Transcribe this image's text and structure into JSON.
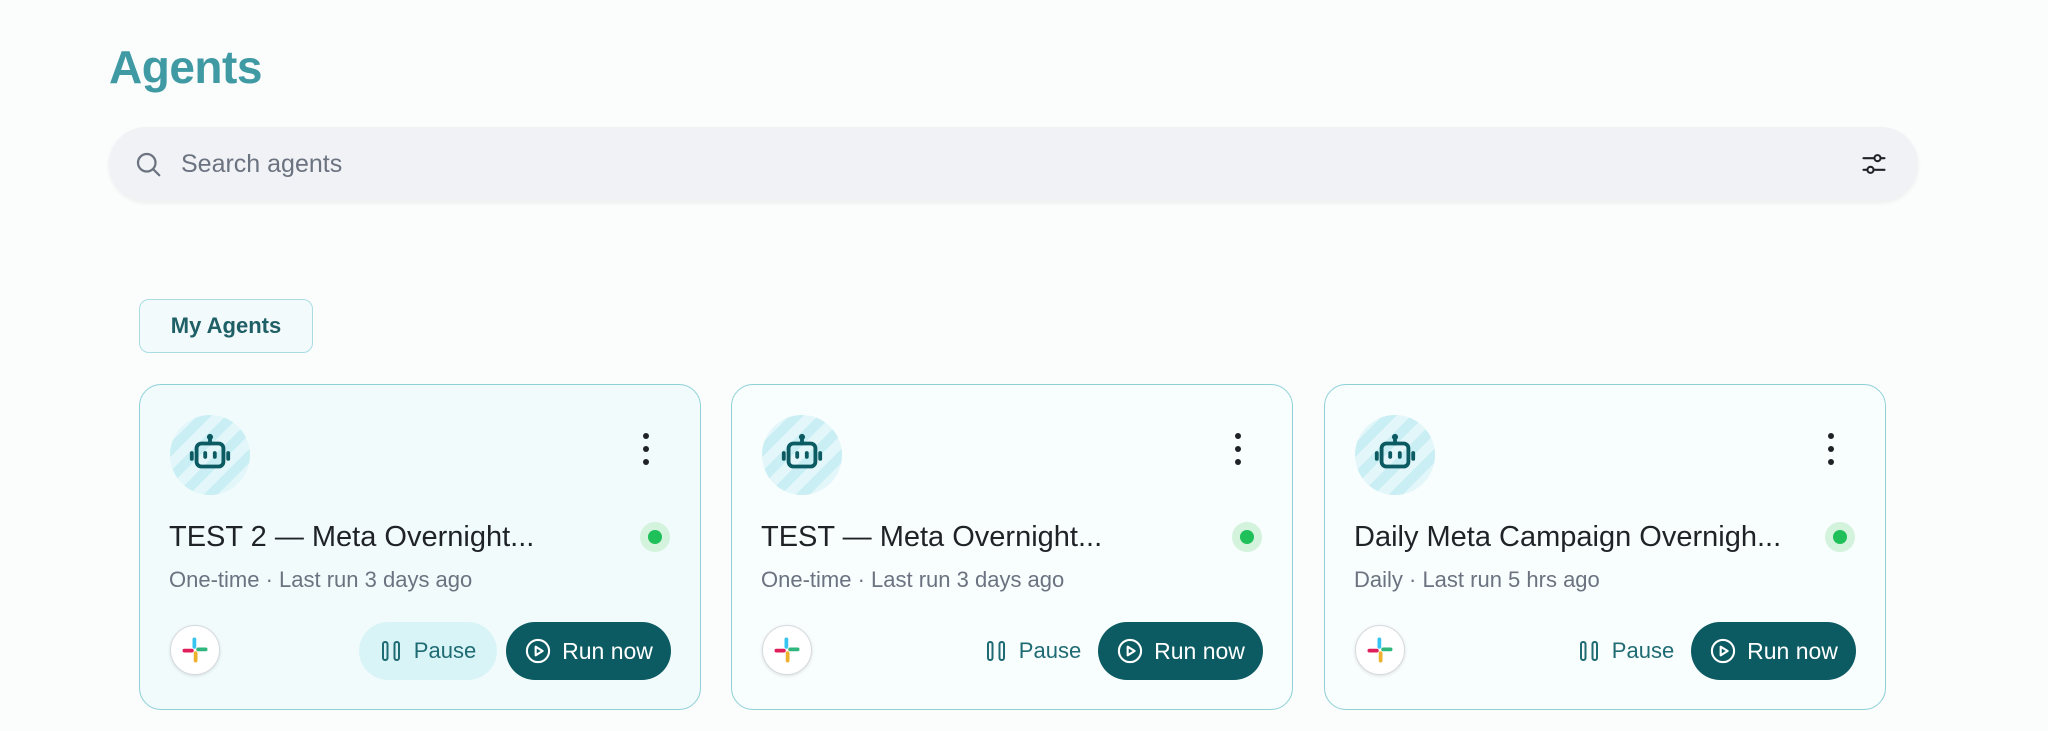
{
  "header": {
    "title": "Agents"
  },
  "search": {
    "placeholder": "Search agents",
    "value": ""
  },
  "tabs": [
    {
      "label": "My Agents"
    }
  ],
  "cards": [
    {
      "name": "TEST 2 — Meta Overnight...",
      "meta": "One-time · Last run 3 days ago",
      "pause_label": "Pause",
      "run_label": "Run now",
      "status": "active"
    },
    {
      "name": "TEST — Meta Overnight...",
      "meta": "One-time · Last run 3 days ago",
      "pause_label": "Pause",
      "run_label": "Run now",
      "status": "active"
    },
    {
      "name": "Daily Meta Campaign Overnigh...",
      "meta": "Daily · Last run 5 hrs ago",
      "pause_label": "Pause",
      "run_label": "Run now",
      "status": "active"
    }
  ],
  "colors": {
    "accent": "#3f9aa4",
    "primary_button": "#0c5b62",
    "status_active": "#1fbf5a"
  },
  "icons": {
    "search": "search-icon",
    "filter": "sliders-icon",
    "agent": "robot-icon",
    "integration": "slack-icon",
    "pause": "pause-icon",
    "run": "play-circle-icon",
    "menu": "kebab-icon"
  }
}
